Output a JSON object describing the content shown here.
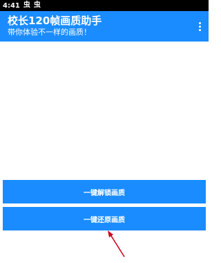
{
  "status_bar": {
    "time": "4:41",
    "icons": [
      "bug-icon",
      "bug-icon"
    ],
    "icon_glyph": "虫"
  },
  "app_bar": {
    "title": "校长120帧画质助手",
    "subtitle": "带你体验不一样的画质！",
    "background": "#1a8cff"
  },
  "buttons": {
    "unlock_label": "一键解锁画质",
    "restore_label": "一键还原画质"
  },
  "annotation": {
    "arrow_color": "#d0021b",
    "arrow_target": "restore-quality-button"
  }
}
